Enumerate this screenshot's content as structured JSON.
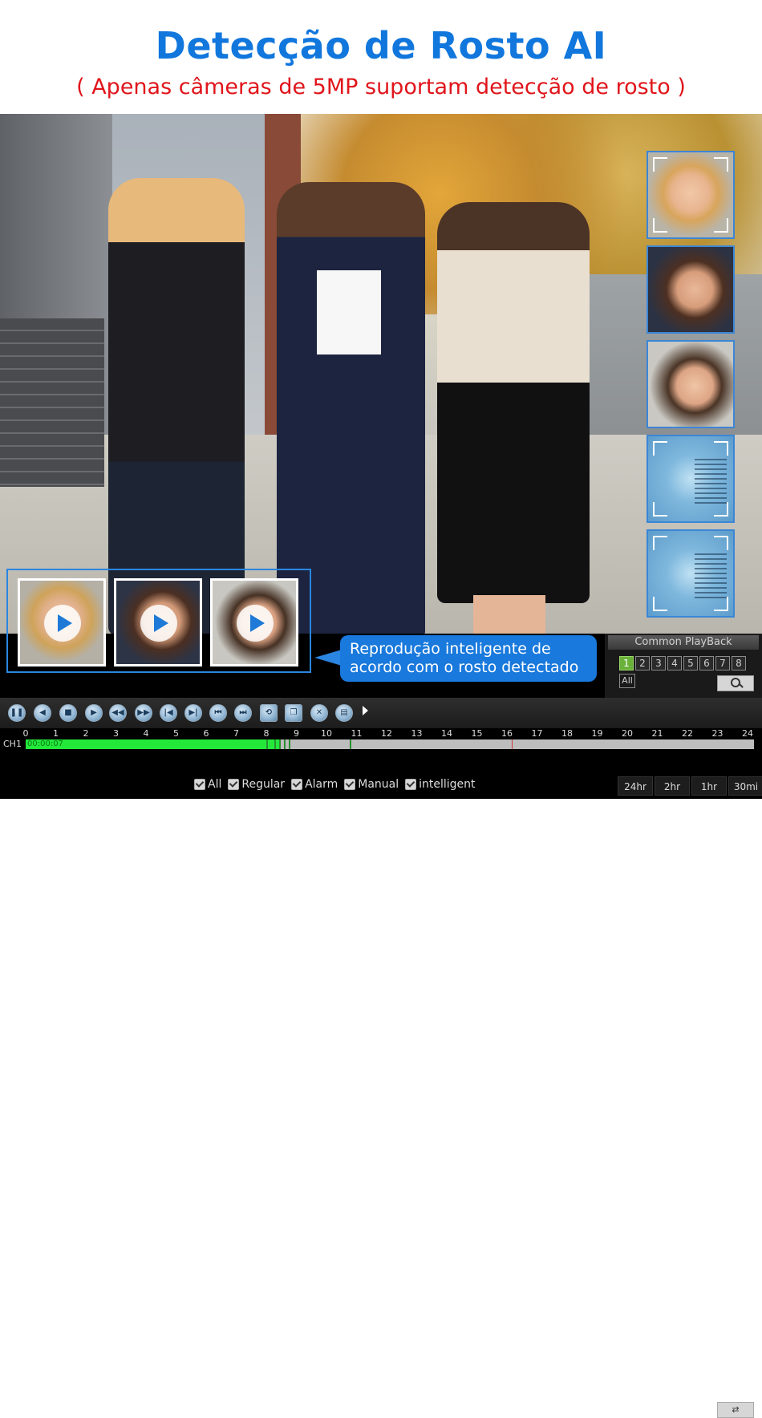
{
  "header": {
    "title": "Detecção de Rosto AI",
    "subtitle": "( Apenas câmeras de 5MP suportam detecção de rosto )"
  },
  "colors": {
    "title": "#1177dd",
    "subtitle": "#e0151b",
    "accent": "#1979dc",
    "timeline_fill": "#23e83a"
  },
  "callout": {
    "line1": "Reprodução inteligente de",
    "line2": "acordo com o rosto detectado"
  },
  "common_playback": {
    "title": "Common PlayBack",
    "channels": [
      "1",
      "2",
      "3",
      "4",
      "5",
      "6",
      "7",
      "8"
    ],
    "active_channel": "1",
    "all_label": "All",
    "search_icon": "search-icon"
  },
  "toolbar": {
    "buttons": [
      "pause-icon",
      "rewind-icon",
      "stop-icon",
      "play-icon",
      "fast-rewind-icon",
      "fast-forward-icon",
      "prev-frame-icon",
      "next-frame-icon",
      "skip-back-icon",
      "skip-forward-icon",
      "loop-icon",
      "copy-icon",
      "cut-icon",
      "save-icon"
    ],
    "swap_icon": "swap-icon"
  },
  "timeline": {
    "hours": [
      "0",
      "1",
      "2",
      "3",
      "4",
      "5",
      "6",
      "7",
      "8",
      "9",
      "10",
      "11",
      "12",
      "13",
      "14",
      "15",
      "16",
      "17",
      "18",
      "19",
      "20",
      "21",
      "22",
      "23",
      "24"
    ],
    "channel_label": "CH1",
    "current_time": "00:00:07",
    "recorded_until_hour": 8.9
  },
  "filters": [
    "All",
    "Regular",
    "Alarm",
    "Manual",
    "intelligent"
  ],
  "zoom_levels": [
    "24hr",
    "2hr",
    "1hr",
    "30mi"
  ]
}
